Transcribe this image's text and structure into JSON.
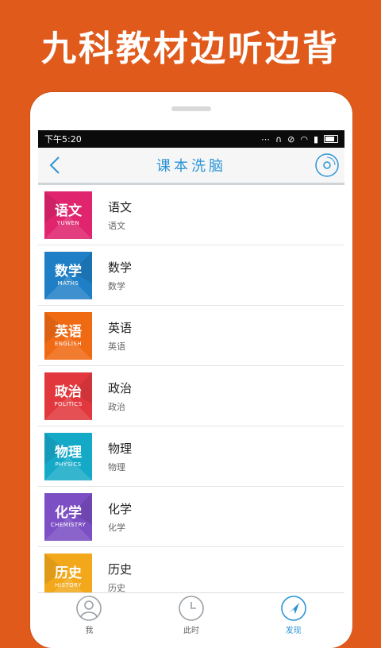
{
  "promo": {
    "headline": "九科教材边听边背"
  },
  "status": {
    "time": "下午5:20",
    "icons": [
      "more-icon",
      "headset-icon",
      "alarm-icon",
      "wifi-icon",
      "signal-icon",
      "battery-icon"
    ]
  },
  "header": {
    "title": "课本洗脑",
    "back_icon": "chevron-left-icon",
    "right_icon": "disc-icon"
  },
  "colors": {
    "accent": "#2a94d6",
    "promo_bg": "#E05A1C"
  },
  "subjects": [
    {
      "badge": "语文",
      "english": "YUWEN",
      "title": "语文",
      "subtitle": "语文",
      "color": "#e0246e"
    },
    {
      "badge": "数学",
      "english": "MATHS",
      "title": "数学",
      "subtitle": "数学",
      "color": "#1f7fc6"
    },
    {
      "badge": "英语",
      "english": "ENGLISH",
      "title": "英语",
      "subtitle": "英语",
      "color": "#f06a14"
    },
    {
      "badge": "政治",
      "english": "POLITICS",
      "title": "政治",
      "subtitle": "政治",
      "color": "#e2383d"
    },
    {
      "badge": "物理",
      "english": "PHYSICS",
      "title": "物理",
      "subtitle": "物理",
      "color": "#15a9c8"
    },
    {
      "badge": "化学",
      "english": "CHEMISTRY",
      "title": "化学",
      "subtitle": "化学",
      "color": "#7c4fc4"
    },
    {
      "badge": "历史",
      "english": "HISTORY",
      "title": "历史",
      "subtitle": "历史",
      "color": "#f2a81a"
    }
  ],
  "tabs": [
    {
      "label": "我",
      "icon": "user-icon"
    },
    {
      "label": "此时",
      "icon": "clock-icon"
    },
    {
      "label": "发现",
      "icon": "compass-icon"
    }
  ]
}
